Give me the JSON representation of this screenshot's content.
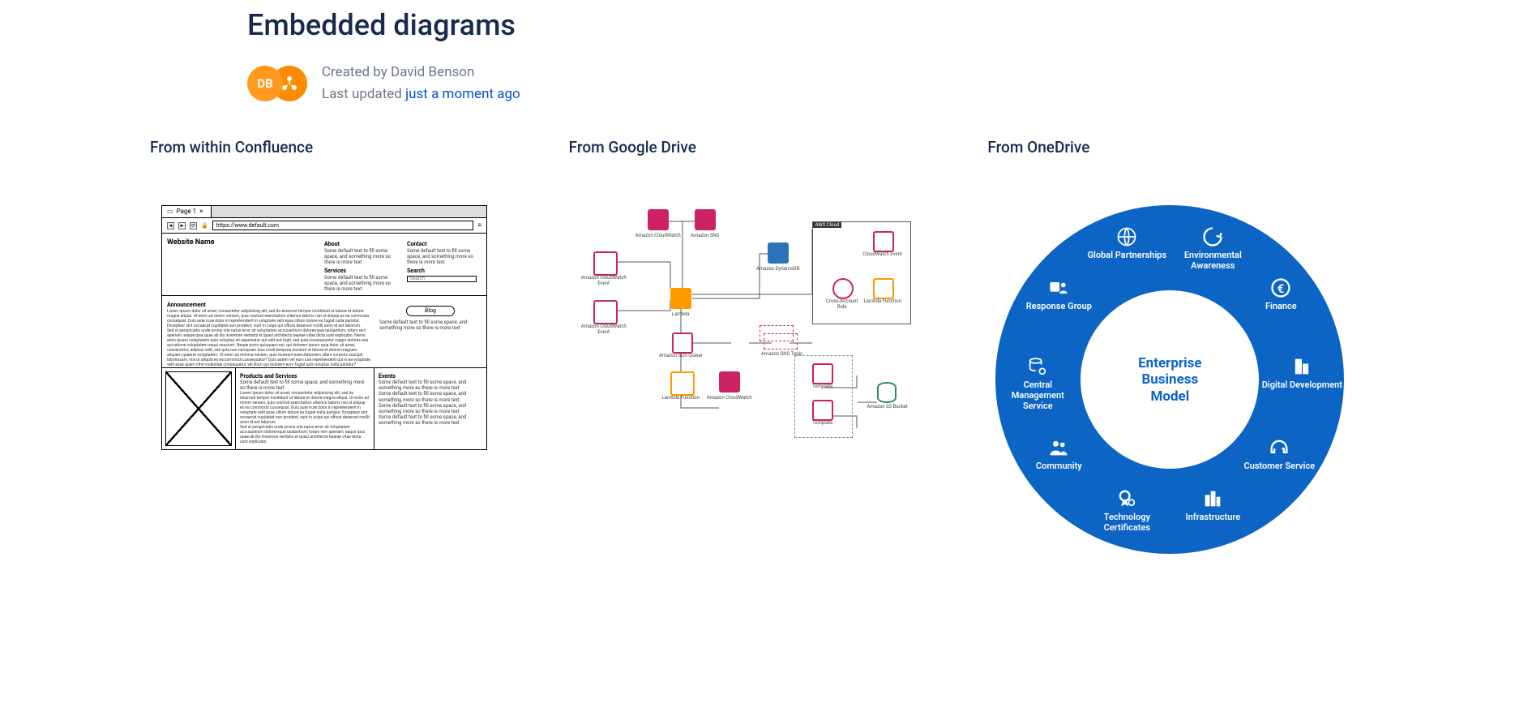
{
  "page": {
    "title": "Embedded diagrams",
    "byline": {
      "avatar_initials": "DB",
      "created_prefix": "Created by ",
      "author": "David Benson",
      "updated_prefix": "Last updated ",
      "updated_relative": "just a moment ago"
    }
  },
  "columns": [
    {
      "heading": "From within Confluence"
    },
    {
      "heading": "From Google Drive"
    },
    {
      "heading": "From OneDrive"
    }
  ],
  "wireframe": {
    "tab": "Page 1",
    "url": "https://www.default.com",
    "site_name": "Website Name",
    "nav": {
      "about": "About",
      "contact": "Contact",
      "services": "Services",
      "search": "Search"
    },
    "search_placeholder": "Search",
    "filler_short": "Some default text to fill some space, and something more so there is more text",
    "announcement": "Announcement",
    "lorem1": "Lorem ipsum dolor sit amet, consectetur adipisicing elit, sed do eiusmod tempor incididunt ut labore et dolore magna aliqua. Ut enim ad minim veniam, quis nostrud exercitation ullamco laboris nisi ut aliquip ex ea commodo consequat. Duis aute irure dolor in reprehenderit in voluptate velit esse cillum dolore eu fugiat nulla pariatur. Excepteur sint occaecat cupidatat non proident, sunt in culpa qui officia deserunt mollit anim id est laborum.",
    "lorem2": "Sed ut perspiciatis unde omnis iste natus error sit voluptatem accusantium doloremque laudantium, totam rem aperiam, eaque ipsa quae ab illo inventore veritatis et quasi architecto beatae vitae dicta sunt explicabo. Nemo enim ipsam voluptatem quia voluptas sit aspernatur aut odit aut fugit, sed quia consequuntur magni dolores eos qui ratione voluptatem sequi nesciunt. Neque porro quisquam est, qui dolorem ipsum quia dolor sit amet, consectetur, adipisci velit, sed quia non numquam eius modi tempora incidunt ut labore et dolore magnam aliquam quaerat voluptatem. Ut enim ad minima veniam, quis nostrum exercitationem ullam corporis suscipit laboriosam, nisi ut aliquid ex ea commodi consequatur? Quis autem vel eum iure reprehenderit qui in ea voluptate velit esse quam nihil molestiae consequatur, vel illum qui dolorem eum fugiat quo voluptas nulla pariatur?",
    "blog": "Blog",
    "products": "Products and Services",
    "events": "Events",
    "lorem3": "Lorem ipsum dolor sit amet, consectetur adipisicing elit, sed do eiusmod tempor incididunt ut labore et dolore magna aliqua. Ut enim ad minim veniam, quis nostrud exercitation ullamco laboris nisi ut aliquip ex ea commodo consequat. Duis aute irure dolor in reprehenderit in voluptate velit esse cillum dolore eu fugiat nulla pariatur. Excepteur sint occaecat cupidatat non proident, sunt in culpa qui officia deserunt mollit anim id est laborum.",
    "lorem4": "Sed ut perspiciatis unde omnis iste natus error sit voluptatem accusantium doloremque laudantium, totam rem aperiam, eaque ipsa quae ab illo inventore veritatis et quasi architecto beatae vitae dicta sunt explicabo."
  },
  "aws": {
    "cloudwatch1": "Amazon CloudWatch",
    "sns": "Amazon SNS",
    "cwe1": "Amazon CloudWatch Event",
    "cwe2": "Amazon CloudWatch Event",
    "lambda": "Lambda",
    "dynamo": "Amazon DynamoDB",
    "sqs": "Amazon SQS Queue",
    "sns_topic": "Amazon SNS Topic",
    "lambda_fn": "Lambda Function",
    "cloudwatch2": "Amazon CloudWatch",
    "template1": "Template",
    "template2": "Template",
    "s3": "Amazon S3 Bucket",
    "cloud_box": "AWS Cloud",
    "cwe_box": "CloudWatch Event",
    "xrole": "Cross-Account Role",
    "lambda_fn2": "Lambda Function"
  },
  "ring": {
    "center": "Enterprise\nBusiness\nModel",
    "segments": [
      "Global Partnerships",
      "Environmental Awareness",
      "Finance",
      "Digital Development",
      "Customer Service",
      "Infrastructure",
      "Technology Certificates",
      "Community",
      "Central Management Service",
      "Response Group"
    ]
  }
}
